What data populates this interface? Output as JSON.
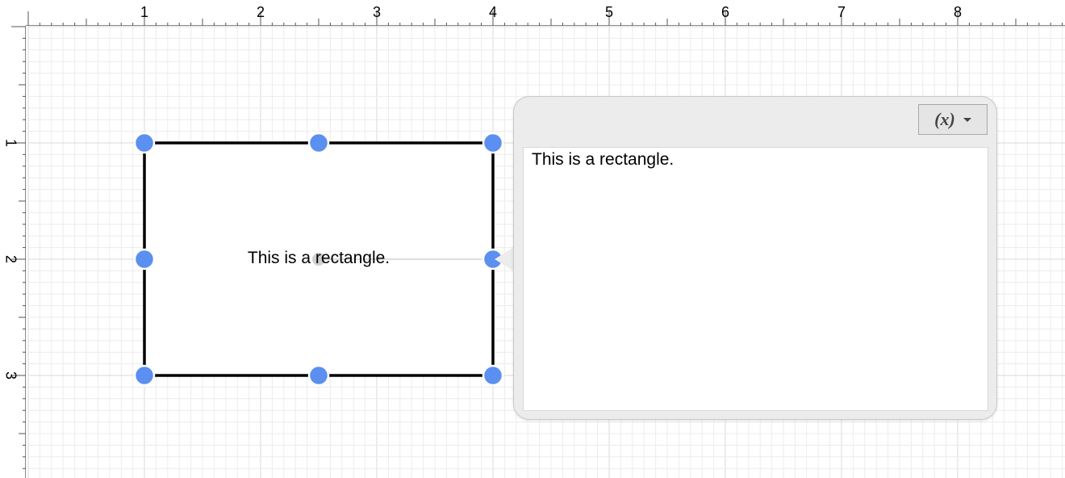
{
  "rulers": {
    "horizontal_ticks": [
      "1",
      "2",
      "3",
      "4",
      "5",
      "6",
      "7",
      "8"
    ],
    "vertical_ticks": [
      "1",
      "2",
      "3"
    ]
  },
  "shape": {
    "label": "This is a rectangle.",
    "stroke_color": "#000000",
    "handle_color": "#5b8ff0"
  },
  "popover": {
    "variable_button_label": "(x)",
    "caret_icon": "chevron-down-icon",
    "text_value": "This is a rectangle."
  }
}
